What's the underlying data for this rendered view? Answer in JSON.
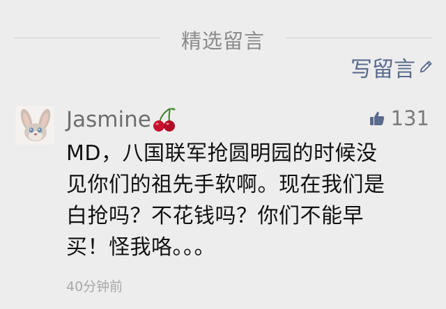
{
  "section": {
    "title": "精选留言"
  },
  "actions": {
    "write_comment_label": "写留言",
    "write_comment_icon": "pencil-icon"
  },
  "comments": [
    {
      "username": "Jasmine",
      "username_emoji": "cherry-icon",
      "avatar_icon": "rabbit-avatar",
      "likes": "131",
      "text": "MD，八国联军抢圆明园的时候没\n见你们的祖先手软啊。现在我们是\n白抢吗？不花钱吗？你们不能早\n买！怪我咯。。。",
      "time": "40分钟前"
    }
  ],
  "colors": {
    "background": "#ededed",
    "link": "#5a6b8e",
    "muted_text": "#8a8a8a",
    "like_icon": "#5a6b8e"
  }
}
